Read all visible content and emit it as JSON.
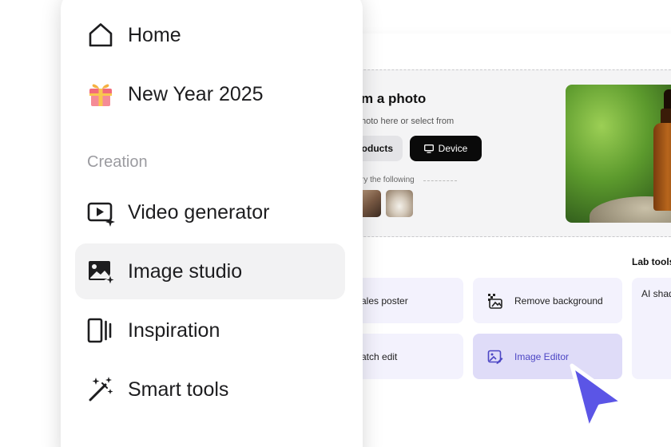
{
  "sidebar": {
    "items": [
      {
        "label": "Home",
        "icon": "home-icon",
        "active": false
      },
      {
        "label": "New Year 2025",
        "icon": "gift-icon",
        "active": false
      },
      {
        "label": "Video generator",
        "icon": "video-generator-icon",
        "active": false
      },
      {
        "label": "Image studio",
        "icon": "image-studio-icon",
        "active": true
      },
      {
        "label": "Inspiration",
        "icon": "inspiration-icon",
        "active": false
      },
      {
        "label": "Smart tools",
        "icon": "magic-wand-icon",
        "active": false
      }
    ],
    "section_label": "Creation"
  },
  "upload": {
    "title": "m a photo",
    "subtitle": "hoto here or select from",
    "products_label": "roducts",
    "device_label": "Device",
    "try_label": "ry the following"
  },
  "tools": {
    "lab_title": "Lab tools",
    "sales_poster": "ales poster",
    "batch_edit": "atch edit",
    "remove_background": "Remove background",
    "image_editor": "Image Editor",
    "ai_shadow": "AI shad"
  },
  "colors": {
    "accent": "#5b55e6",
    "active_card": "#dfdcf8",
    "card": "#f3f2fd",
    "device_button": "#0a0a0a",
    "gift_pink": "#f26b7a"
  }
}
